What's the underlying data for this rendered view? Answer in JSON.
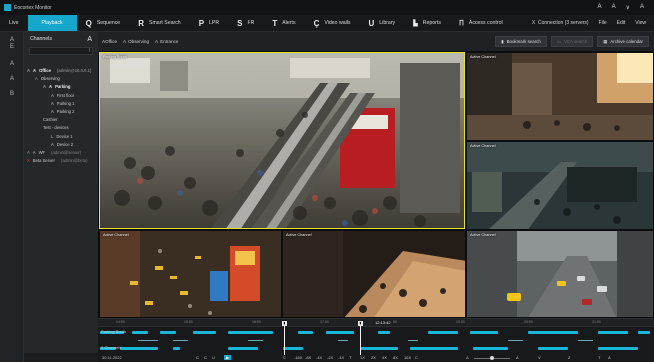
{
  "app": {
    "title": "Eocortex Monitor"
  },
  "window_controls": [
    "A",
    "A",
    "∨",
    "A"
  ],
  "nav": {
    "tabs": [
      {
        "icon": "",
        "label": "Live",
        "active": false
      },
      {
        "icon": "",
        "label": "Playback",
        "active": true
      },
      {
        "icon": "Q",
        "label": "Sequence",
        "active": false
      },
      {
        "icon": "R",
        "label": "Smart Search",
        "active": false
      },
      {
        "icon": "P",
        "label": "LPR",
        "active": false
      },
      {
        "icon": "S",
        "label": "FR",
        "active": false
      },
      {
        "icon": "T",
        "label": "Alerts",
        "active": false
      },
      {
        "icon": "Ç",
        "label": "Video walls",
        "active": false
      },
      {
        "icon": "U",
        "label": "Library",
        "active": false
      },
      {
        "icon": "▙",
        "label": "Reports",
        "active": false
      },
      {
        "icon": "∏",
        "label": "Access control",
        "active": false
      }
    ],
    "right": {
      "connection": "Connection (3 servers)",
      "file": "File",
      "edit": "Edit",
      "view": "View",
      "connection_icon": "X"
    }
  },
  "rail": {
    "items": [
      "A",
      "E",
      "A",
      "A",
      "B"
    ]
  },
  "channels": {
    "header": "Channels",
    "add_icon": "A",
    "search_icon": "I",
    "tree": [
      {
        "indent": 0,
        "toggle": "A",
        "icon": "A",
        "label": "Office",
        "extra": "(admin@10.0.0.1)",
        "bold": true
      },
      {
        "indent": 1,
        "toggle": "A",
        "icon": "",
        "label": "Observing",
        "extra": "",
        "bold": false
      },
      {
        "indent": 2,
        "toggle": "A",
        "icon": "A",
        "label": "Parking",
        "extra": "",
        "bold": true
      },
      {
        "indent": 3,
        "toggle": "",
        "icon": "A",
        "label": "First floor",
        "extra": "",
        "bold": false
      },
      {
        "indent": 3,
        "toggle": "",
        "icon": "A",
        "label": "Parking 1",
        "extra": "",
        "bold": false
      },
      {
        "indent": 3,
        "toggle": "",
        "icon": "A",
        "label": "Parking 2",
        "extra": "",
        "bold": false
      },
      {
        "indent": 2,
        "toggle": "",
        "icon": "",
        "label": "Cashier",
        "extra": "",
        "bold": false
      },
      {
        "indent": 2,
        "toggle": "",
        "icon": "",
        "label": "Test - devices",
        "extra": "",
        "bold": false
      },
      {
        "indent": 3,
        "toggle": "",
        "icon": "L",
        "label": "Device 1",
        "extra": "",
        "bold": false
      },
      {
        "indent": 3,
        "toggle": "",
        "icon": "A",
        "label": "Device 2",
        "extra": "",
        "bold": false
      },
      {
        "indent": 0,
        "toggle": "A",
        "icon": "A",
        "label": "WF",
        "extra": "(admin@server)",
        "bold": false
      },
      {
        "indent": 0,
        "toggle": "",
        "icon": "X",
        "label": "Beta Server",
        "extra": "(admin@beta)",
        "bold": false,
        "error": true
      }
    ]
  },
  "layout_toolbar": {
    "breadcrumb": [
      {
        "icon": "A",
        "label": "Office"
      },
      {
        "icon": "A",
        "label": "Observing"
      },
      {
        "icon": "A",
        "label": "Entrance"
      }
    ],
    "bookmark_btn": "Bookmark search",
    "vca_btn": "VCA search",
    "archive_btn": "Archive calendar"
  },
  "cells": [
    {
      "label": "Parking South",
      "selected": true
    },
    {
      "label": "Active Channel",
      "selected": false
    },
    {
      "label": "Active Channel",
      "selected": false
    },
    {
      "label": "Active Channel",
      "selected": false
    },
    {
      "label": "Active Channel",
      "selected": false
    },
    {
      "label": "Active Channel",
      "selected": false
    }
  ],
  "timeline": {
    "ticks": [
      "14:00",
      "15:00",
      "16:00",
      "17:00",
      "18:00",
      "19:00",
      "20:00",
      "21:00"
    ],
    "current_time": "12:13:42",
    "rows": [
      {
        "name": "Parking South"
      },
      {
        "name": ""
      },
      {
        "name": "6 Channels"
      }
    ],
    "controls": {
      "date": "30.11.2022",
      "step_back": "C",
      "play_rev": "C",
      "pause": "U",
      "play": "▶",
      "speeds": [
        "C",
        "-16X",
        "-8X",
        "-4X",
        "-2X",
        "-1X",
        "T",
        "1X",
        "2X",
        "4X",
        "8X",
        "16X",
        "C"
      ],
      "zoom_out": "A",
      "zoom_in": "A",
      "export": "V",
      "settings": "Z",
      "filter": "T",
      "screenshot": "A"
    }
  },
  "colors": {
    "accent": "#15a8cc",
    "selected_border": "#e6e32a",
    "segment": "#18b6d8"
  }
}
